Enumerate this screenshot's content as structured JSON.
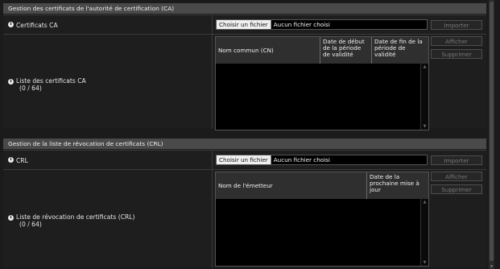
{
  "ca_section": {
    "header": "Gestion des certificats de l'autorité de certification (CA)",
    "cert_row_label": "Certificats CA",
    "file_button": "Choisir un fichier",
    "file_status": "Aucun fichier choisi",
    "import_button": "Importer",
    "list_label": "Liste des certificats CA",
    "list_count": "(0 / 64)",
    "columns": [
      "Nom commun (CN)",
      "Date de début de la période de validité",
      "Date de fin de la période de validité"
    ],
    "show_button": "Afficher",
    "delete_button": "Supprimer"
  },
  "crl_section": {
    "header": "Gestion de la liste de révocation de certificats (CRL)",
    "crl_row_label": "CRL",
    "file_button": "Choisir un fichier",
    "file_status": "Aucun fichier choisi",
    "import_button": "Importer",
    "list_label": "Liste de révocation de certificats (CRL)",
    "list_count": "(0 / 64)",
    "columns": [
      "Nom de l'émetteur",
      "Date de la prochaine mise à jour"
    ],
    "show_button": "Afficher",
    "delete_button": "Supprimer"
  },
  "icons": {
    "info": "info-icon",
    "scroll_up": "scroll-up-arrow-icon",
    "scroll_down": "scroll-down-arrow-icon"
  },
  "colors": {
    "background": "#1b1b1b",
    "header": "#4a4a4a",
    "table": "#000000"
  }
}
